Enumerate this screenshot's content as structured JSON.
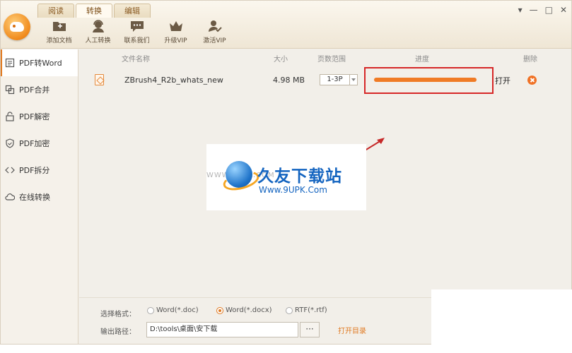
{
  "tabs": [
    "阅读",
    "转换",
    "编辑"
  ],
  "toolbar": {
    "add_doc": "添加文档",
    "manual": "人工转换",
    "contact": "联系我们",
    "upgrade": "升级VIP",
    "activate": "激活VIP"
  },
  "window_controls": [
    "▾",
    "—",
    "□",
    "✕"
  ],
  "sidebar": {
    "items": [
      {
        "label": "PDF转Word",
        "icon": "word-doc-icon"
      },
      {
        "label": "PDF合并",
        "icon": "merge-icon"
      },
      {
        "label": "PDF解密",
        "icon": "unlock-icon"
      },
      {
        "label": "PDF加密",
        "icon": "shield-icon"
      },
      {
        "label": "PDF拆分",
        "icon": "split-icon"
      },
      {
        "label": "在线转换",
        "icon": "cloud-icon"
      }
    ]
  },
  "columns": {
    "name": "文件名称",
    "size": "大小",
    "range": "页数范围",
    "progress": "进度",
    "delete": "删除"
  },
  "file": {
    "name": "ZBrush4_R2b_whats_new",
    "size": "4.98 MB",
    "range": "1-3P",
    "progress": 1.0,
    "open": "打开"
  },
  "watermark": {
    "brand": "久友下载站",
    "url": "Www.9UPK.Com",
    "url_faint": "WWW.9UPK.COM"
  },
  "footer": {
    "format_label": "选择格式：",
    "formats": [
      {
        "label": "Word(*.doc)",
        "selected": false
      },
      {
        "label": "Word(*.docx)",
        "selected": true
      },
      {
        "label": "RTF(*.rtf)",
        "selected": false
      }
    ],
    "path_label": "输出路径：",
    "path_value": "D:\\tools\\桌面\\安下载",
    "browse": "···",
    "open_dir": "打开目录"
  },
  "colors": {
    "accent": "#f07b25",
    "highlight_box": "#d62727"
  }
}
